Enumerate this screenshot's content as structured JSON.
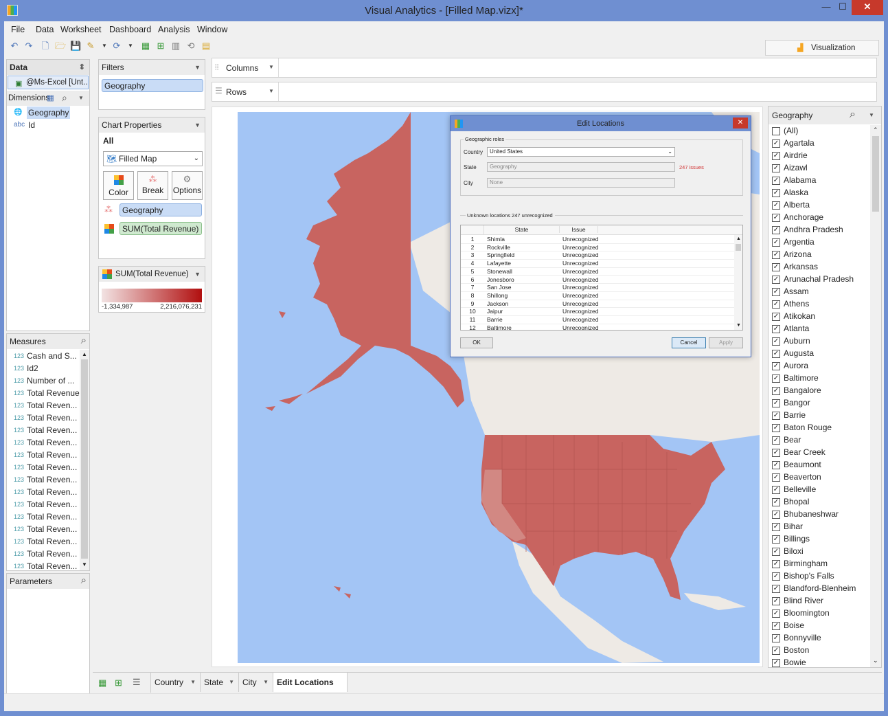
{
  "window": {
    "title": "Visual Analytics - [Filled Map.vizx]*",
    "min": "—",
    "max": "☐",
    "close": "✕"
  },
  "menu": [
    "File",
    "Data",
    "Worksheet",
    "Dashboard",
    "Analysis",
    "Window"
  ],
  "visualization_tab": "Visualization",
  "data_panel": {
    "title": "Data",
    "source": "@Ms-Excel [Unt...",
    "dimensions_label": "Dimensions",
    "dimensions": [
      {
        "type": "geo",
        "name": "Geography"
      },
      {
        "type": "abc",
        "name": "Id"
      }
    ]
  },
  "measures_panel": {
    "title": "Measures",
    "items": [
      "Cash and S...",
      "Id2",
      "Number of ...",
      "Total Revenue",
      "Total Reven...",
      "Total Reven...",
      "Total Reven...",
      "Total Reven...",
      "Total Reven...",
      "Total Reven...",
      "Total Reven...",
      "Total Reven...",
      "Total Reven...",
      "Total Reven...",
      "Total Reven...",
      "Total Reven...",
      "Total Reven...",
      "Total Reven..."
    ],
    "type_label": "123"
  },
  "parameters_panel": {
    "title": "Parameters"
  },
  "filters": {
    "title": "Filters",
    "items": [
      "Geography"
    ]
  },
  "chart_properties": {
    "title": "Chart Properties",
    "all": "All",
    "chart_type": "Filled Map",
    "buttons": [
      "Color",
      "Break",
      "Options"
    ],
    "break_field": "Geography",
    "color_field": "SUM(Total Revenue)"
  },
  "legend": {
    "title": "SUM(Total Revenue)",
    "min": "-1,334,987",
    "max": "2,216,076,231",
    "color_low": "#f2e3e3",
    "color_high": "#b10f0f"
  },
  "shelves": {
    "columns": "Columns",
    "rows": "Rows"
  },
  "map": {
    "fill": "#c86460",
    "fill_light": "#d28883",
    "water": "#a3c5f5",
    "land": "#eeeae5"
  },
  "dialog": {
    "title": "Edit Locations",
    "group": "Geographic roles",
    "country_label": "Country",
    "country_value": "United States",
    "state_label": "State",
    "state_value": "Geography",
    "state_issues": "247 issues",
    "city_label": "City",
    "city_value": "None",
    "unknown_label": "Unknown locations  247 unrecognized",
    "col_state": "State",
    "col_issue": "Issue",
    "rows": [
      {
        "n": "1",
        "state": "Shimla",
        "issue": "Unrecognized"
      },
      {
        "n": "2",
        "state": "Rockville",
        "issue": "Unrecognized"
      },
      {
        "n": "3",
        "state": "Springfield",
        "issue": "Unrecognized"
      },
      {
        "n": "4",
        "state": "Lafayette",
        "issue": "Unrecognized"
      },
      {
        "n": "5",
        "state": "Stonewall",
        "issue": "Unrecognized"
      },
      {
        "n": "6",
        "state": "Jonesboro",
        "issue": "Unrecognized"
      },
      {
        "n": "7",
        "state": "San Jose",
        "issue": "Unrecognized"
      },
      {
        "n": "8",
        "state": "Shillong",
        "issue": "Unrecognized"
      },
      {
        "n": "9",
        "state": "Jackson",
        "issue": "Unrecognized"
      },
      {
        "n": "10",
        "state": "Jaipur",
        "issue": "Unrecognized"
      },
      {
        "n": "11",
        "state": "Barrie",
        "issue": "Unrecognized"
      },
      {
        "n": "12",
        "state": "Baltimore",
        "issue": "Unrecognized"
      }
    ],
    "ok": "OK",
    "cancel": "Cancel",
    "apply": "Apply"
  },
  "geography_filter": {
    "title": "Geography",
    "items": [
      {
        "name": "(All)",
        "checked": false
      },
      {
        "name": "Agartala",
        "checked": true
      },
      {
        "name": "Airdrie",
        "checked": true
      },
      {
        "name": "Aizawl",
        "checked": true
      },
      {
        "name": "Alabama",
        "checked": true
      },
      {
        "name": "Alaska",
        "checked": true
      },
      {
        "name": "Alberta",
        "checked": true
      },
      {
        "name": "Anchorage",
        "checked": true
      },
      {
        "name": "Andhra Pradesh",
        "checked": true
      },
      {
        "name": "Argentia",
        "checked": true
      },
      {
        "name": "Arizona",
        "checked": true
      },
      {
        "name": "Arkansas",
        "checked": true
      },
      {
        "name": "Arunachal Pradesh",
        "checked": true
      },
      {
        "name": "Assam",
        "checked": true
      },
      {
        "name": "Athens",
        "checked": true
      },
      {
        "name": "Atikokan",
        "checked": true
      },
      {
        "name": "Atlanta",
        "checked": true
      },
      {
        "name": "Auburn",
        "checked": true
      },
      {
        "name": "Augusta",
        "checked": true
      },
      {
        "name": "Aurora",
        "checked": true
      },
      {
        "name": "Baltimore",
        "checked": true
      },
      {
        "name": "Bangalore",
        "checked": true
      },
      {
        "name": "Bangor",
        "checked": true
      },
      {
        "name": "Barrie",
        "checked": true
      },
      {
        "name": "Baton Rouge",
        "checked": true
      },
      {
        "name": "Bear",
        "checked": true
      },
      {
        "name": "Bear Creek",
        "checked": true
      },
      {
        "name": "Beaumont",
        "checked": true
      },
      {
        "name": "Beaverton",
        "checked": true
      },
      {
        "name": "Belleville",
        "checked": true
      },
      {
        "name": "Bhopal",
        "checked": true
      },
      {
        "name": "Bhubaneshwar",
        "checked": true
      },
      {
        "name": "Bihar",
        "checked": true
      },
      {
        "name": "Billings",
        "checked": true
      },
      {
        "name": "Biloxi",
        "checked": true
      },
      {
        "name": "Birmingham",
        "checked": true
      },
      {
        "name": "Bishop's Falls",
        "checked": true
      },
      {
        "name": "Blandford-Blenheim",
        "checked": true
      },
      {
        "name": "Blind River",
        "checked": true
      },
      {
        "name": "Bloomington",
        "checked": true
      },
      {
        "name": "Boise",
        "checked": true
      },
      {
        "name": "Bonnyville",
        "checked": true
      },
      {
        "name": "Boston",
        "checked": true
      },
      {
        "name": "Bowie",
        "checked": true
      }
    ]
  },
  "sheet_tabs": [
    {
      "name": "Country",
      "active": false
    },
    {
      "name": "State",
      "active": false
    },
    {
      "name": "City",
      "active": false
    },
    {
      "name": "Edit Locations",
      "active": true
    }
  ]
}
